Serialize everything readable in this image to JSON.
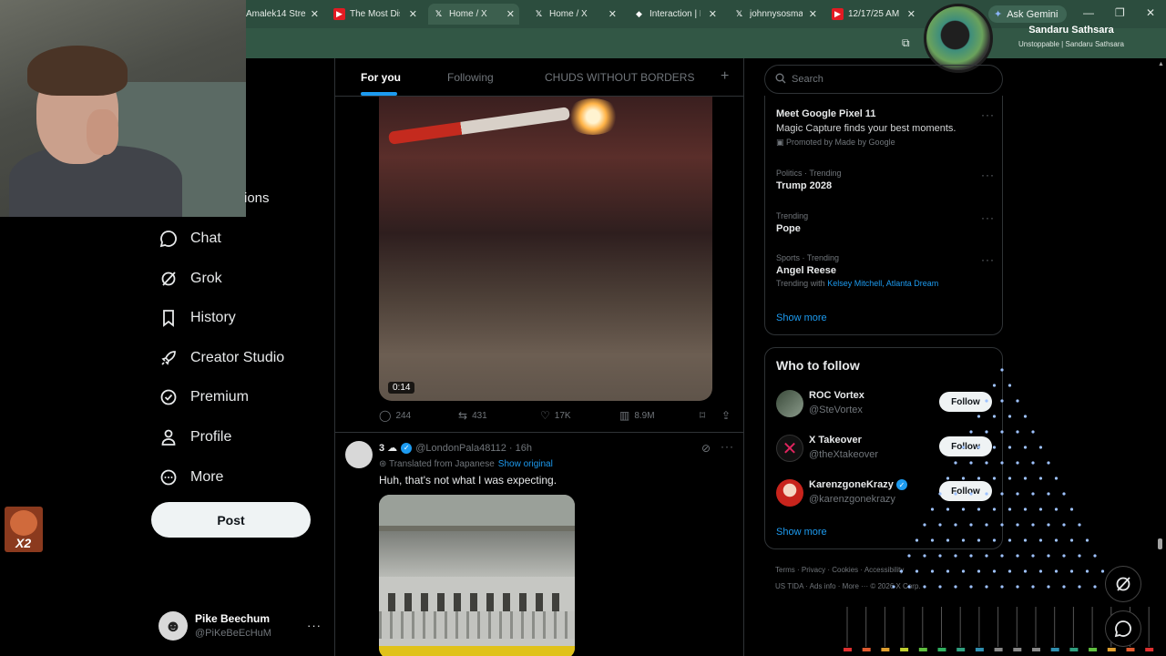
{
  "browser": {
    "tabs": [
      {
        "label": "Amalek14 Stre",
        "icon": "none"
      },
      {
        "label": "The Most Disg",
        "icon": "youtube-icon"
      },
      {
        "label": "Home / X",
        "icon": "x-icon",
        "active": true
      },
      {
        "label": "Home / X",
        "icon": "x-icon"
      },
      {
        "label": "Interaction | B",
        "icon": "diamond-icon"
      },
      {
        "label": "johnnysosmal",
        "icon": "x-icon"
      },
      {
        "label": "12/17/25 AM",
        "icon": "youtube-icon"
      }
    ],
    "ask_gemini": "Ask Gemini",
    "colors": {
      "chrome": "#2c4d3e",
      "accent": "#1d9bf0"
    }
  },
  "overlay": {
    "profile_name": "Sandaru Sathsara",
    "profile_sub": "Unstoppable | Sandaru Sathsara",
    "badge": "X2",
    "partial_nav_text": "ions"
  },
  "nav": {
    "items": [
      {
        "label": "Chat",
        "icon": "chat-icon"
      },
      {
        "label": "Grok",
        "icon": "grok-icon"
      },
      {
        "label": "History",
        "icon": "bookmark-icon"
      },
      {
        "label": "Creator Studio",
        "icon": "rocket-icon"
      },
      {
        "label": "Premium",
        "icon": "premium-icon"
      },
      {
        "label": "Profile",
        "icon": "person-icon"
      },
      {
        "label": "More",
        "icon": "more-circle-icon"
      }
    ],
    "post_label": "Post",
    "account": {
      "name": "Pike Beechum",
      "handle": "@PiKeBeEcHuM",
      "more": "···"
    }
  },
  "feed": {
    "tabs": [
      {
        "label": "For you",
        "active": true
      },
      {
        "label": "Following"
      },
      {
        "label": "CHUDS WITHOUT BORDERS"
      }
    ],
    "add_tab": "+",
    "tweet1": {
      "video_time": "0:14",
      "replies": "244",
      "reposts": "431",
      "likes": "17K",
      "views": "8.9M"
    },
    "tweet2": {
      "name": "3 ☁",
      "handle": "@LondonPala48112",
      "time": "· 16h",
      "translated": "Translated from Japanese",
      "show_original": "Show original",
      "text": "Huh, that's not what I was expecting."
    }
  },
  "sidebar": {
    "search_placeholder": "Search",
    "ad": {
      "title": "Meet Google Pixel 11",
      "desc": "Magic Capture finds your best moments.",
      "promoted": "Promoted by Made by Google"
    },
    "trends": [
      {
        "meta": "Politics · Trending",
        "title": "Trump 2028"
      },
      {
        "meta": "Trending",
        "title": "Pope"
      },
      {
        "meta": "Sports · Trending",
        "title": "Angel Reese",
        "sub_prefix": "Trending with",
        "sub_links": "Kelsey Mitchell, Atlanta Dream"
      }
    ],
    "show_more": "Show more",
    "who_to_follow": {
      "title": "Who to follow",
      "accounts": [
        {
          "name": "ROC Vortex",
          "handle": "@SteVortex",
          "follow": "Follow",
          "verified": false
        },
        {
          "name": "X Takeover",
          "handle": "@theXtakeover",
          "follow": "Follow",
          "verified": false
        },
        {
          "name": "KarenzgoneKrazy",
          "handle": "@karenzgonekrazy",
          "follow": "Follow",
          "verified": true
        }
      ],
      "show_more": "Show more"
    },
    "footer": {
      "line1": [
        "Terms",
        "Privacy",
        "Cookies",
        "Accessibility"
      ],
      "line2": [
        "US TIDA",
        "Ads info",
        "More ···",
        "© 2026 X Corp."
      ]
    }
  }
}
